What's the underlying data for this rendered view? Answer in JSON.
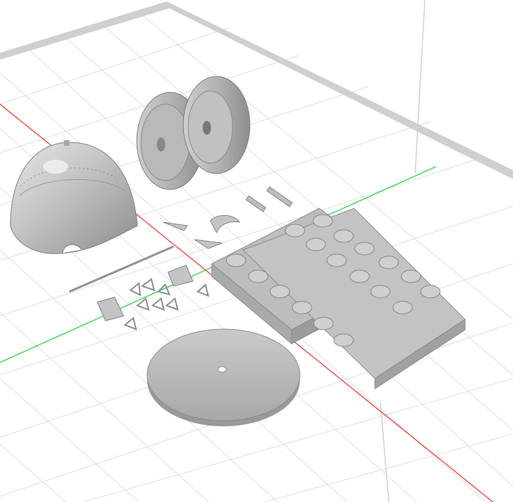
{
  "scene": {
    "background": "#ffffff",
    "grid_color": "#d9d9d9",
    "x_axis_color": "#e53935",
    "y_axis_color": "#2ecc40",
    "z_axis_color": "#cfcfcf",
    "bed_border_color": "#cfcfcf",
    "model_color": "#bdbdbd",
    "model_shade_color": "#8f8f8f",
    "objects": [
      "propeller-spinner",
      "dual-wheels",
      "exhaust-stack-sprue",
      "circular-display-base",
      "small-parts-cluster"
    ]
  }
}
